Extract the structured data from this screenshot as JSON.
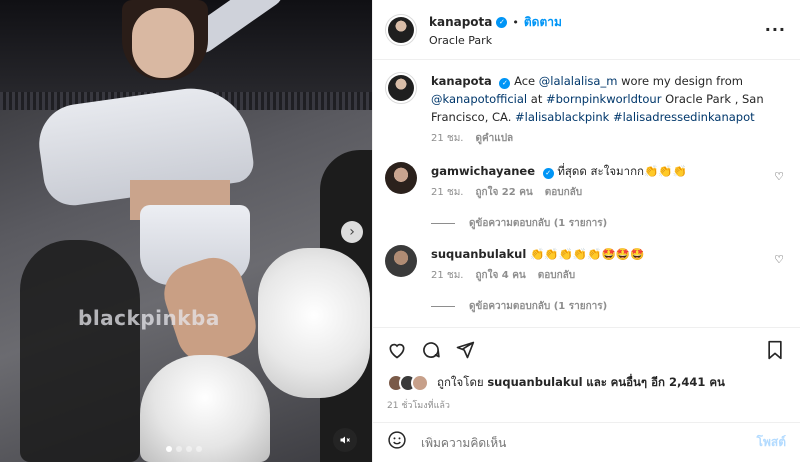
{
  "media": {
    "watermark": "blackpinkba",
    "next_icon": "chevron-right-icon",
    "mute_icon": "speaker-muted-icon",
    "carousel_dots": 4,
    "active_dot": 1
  },
  "header": {
    "username": "kanapota",
    "separator": "•",
    "follow_label": "ติดตาม",
    "location": "Oracle Park",
    "more_label": "···"
  },
  "caption": {
    "username": "kanapota",
    "text_prefix": "Ace",
    "mention": "@lalalalisa_m",
    "text_mid": "wore my design from",
    "mention2": "@kanapotofficial",
    "text_at": "at",
    "tag1": "#bornpinkworldtour",
    "text_place": "Oracle Park , San Francisco, CA.",
    "tag2": "#lalisablackpink",
    "tag3": "#lalisadressedinkanapot",
    "time": "21 ชม.",
    "translate_label": "ดูคำแปล"
  },
  "comments": [
    {
      "username": "gamwichayanee",
      "text": "ที่สุดด สะใจมากก👏👏👏",
      "time": "21 ชม.",
      "likes": "ถูกใจ 22 คน",
      "reply_label": "ตอบกลับ",
      "view_replies": "ดูข้อความตอบกลับ (1 รายการ)"
    },
    {
      "username": "suquanbulakul",
      "text": "👏👏👏👏👏🤩🤩🤩",
      "time": "21 ชม.",
      "likes": "ถูกใจ 4 คน",
      "reply_label": "ตอบกลับ",
      "view_replies": "ดูข้อความตอบกลับ (1 รายการ)"
    }
  ],
  "actions": {
    "like_icon": "heart-outline-icon",
    "comment_icon": "comment-bubble-icon",
    "share_icon": "paper-plane-icon",
    "save_icon": "bookmark-icon"
  },
  "likes": {
    "prefix": "ถูกใจโดย",
    "user": "suquanbulakul",
    "and": "และ",
    "others": "คนอื่นๆ อีก 2,441 คน"
  },
  "post_time": "21 ชั่วโมงที่แล้ว",
  "add_comment": {
    "placeholder": "เพิ่มความคิดเห็น",
    "post_label": "โพสต์"
  },
  "colors": {
    "accent": "#0095f6",
    "link": "#00376b",
    "muted": "#8e8e8e",
    "post_disabled": "#b3dbff"
  }
}
